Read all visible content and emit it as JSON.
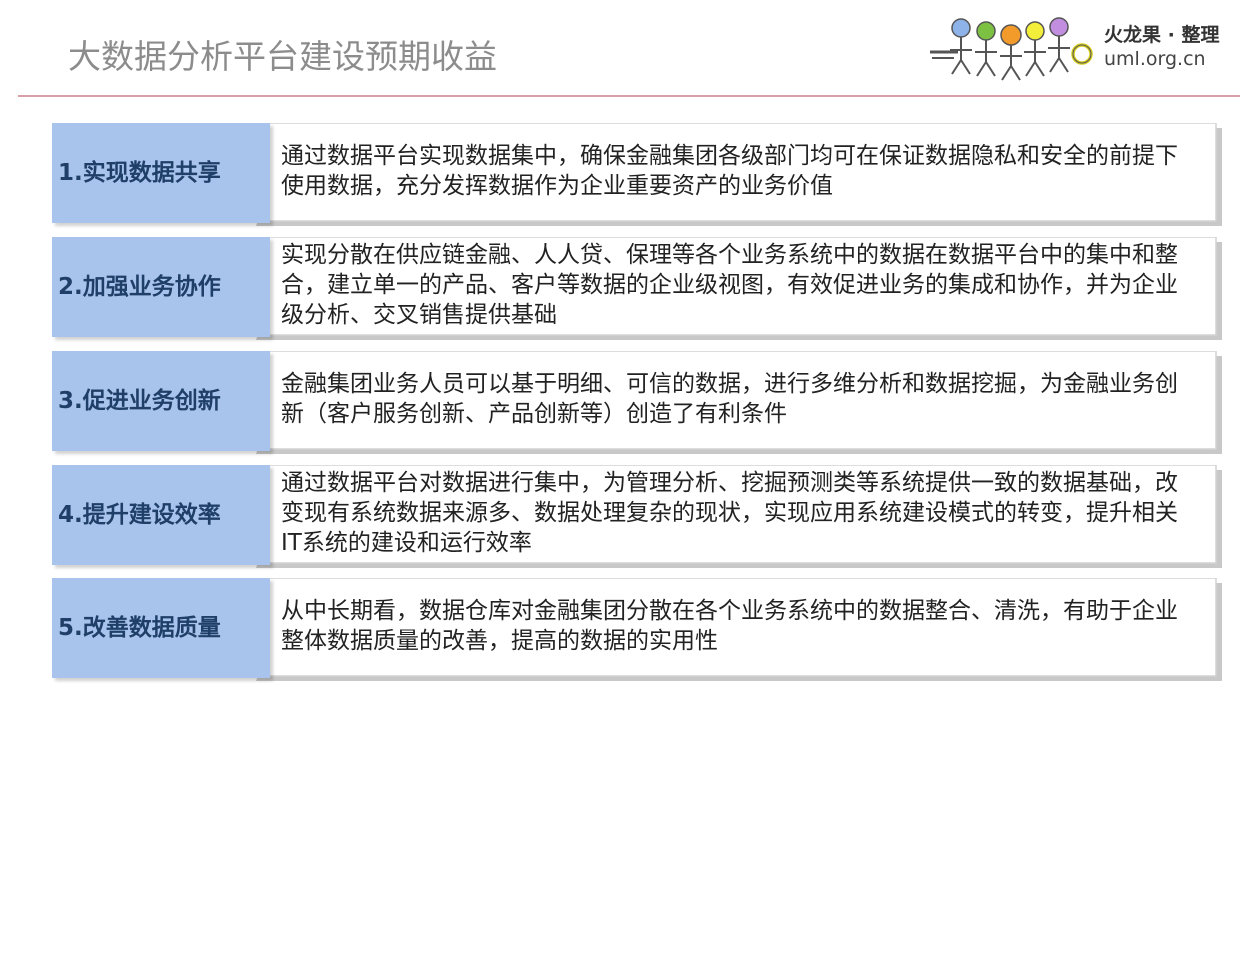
{
  "header": {
    "title": "大数据分析平台建设预期收益",
    "logo_line1": "火龙果 · 整理",
    "logo_line2": "uml.org.cn"
  },
  "colors": {
    "label_bg": "#a9c4ec",
    "label_text": "#1f3f68",
    "rule": "#d7a0a8",
    "title": "#8c8c8c"
  },
  "rows": [
    {
      "label": "1.实现数据共享",
      "text": "通过数据平台实现数据集中，确保金融集团各级部门均可在保证数据隐私和安全的前提下使用数据，充分发挥数据作为企业重要资产的业务价值"
    },
    {
      "label": "2.加强业务协作",
      "text": "实现分散在供应链金融、人人贷、保理等各个业务系统中的数据在数据平台中的集中和整合，建立单一的产品、客户等数据的企业级视图，有效促进业务的集成和协作，并为企业级分析、交叉销售提供基础"
    },
    {
      "label": "3.促进业务创新",
      "text": "金融集团业务人员可以基于明细、可信的数据，进行多维分析和数据挖掘，为金融业务创新（客户服务创新、产品创新等）创造了有利条件"
    },
    {
      "label": "4.提升建设效率",
      "text": "通过数据平台对数据进行集中，为管理分析、挖掘预测类等系统提供一致的数据基础，改变现有系统数据来源多、数据处理复杂的现状，实现应用系统建设模式的转变，提升相关IT系统的建设和运行效率"
    },
    {
      "label": "5.改善数据质量",
      "text": "从中长期看，数据仓库对金融集团分散在各个业务系统中的数据整合、清洗，有助于企业整体数据质量的改善，提高的数据的实用性"
    }
  ]
}
